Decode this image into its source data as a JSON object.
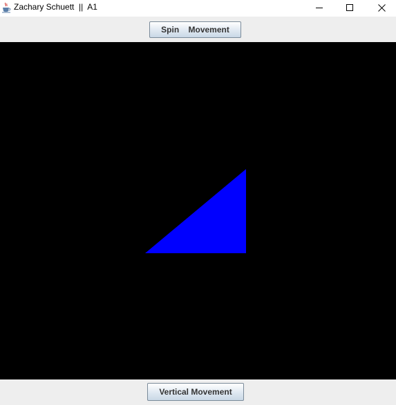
{
  "window": {
    "title": "Zachary Schuett  ||  A1",
    "icon": "java-cup-icon",
    "controls": [
      "minimize-icon",
      "maximize-icon",
      "close-icon"
    ]
  },
  "top_panel": {
    "spin_button_label": "Spin    Movement"
  },
  "canvas": {
    "background": "#000000",
    "shape": {
      "type": "triangle",
      "fill": "#0000ff"
    }
  },
  "bottom_panel": {
    "vertical_button_label": "Vertical Movement"
  },
  "colors": {
    "panel": "#eeeeee",
    "canvas": "#000000",
    "triangle": "#0000ff"
  }
}
